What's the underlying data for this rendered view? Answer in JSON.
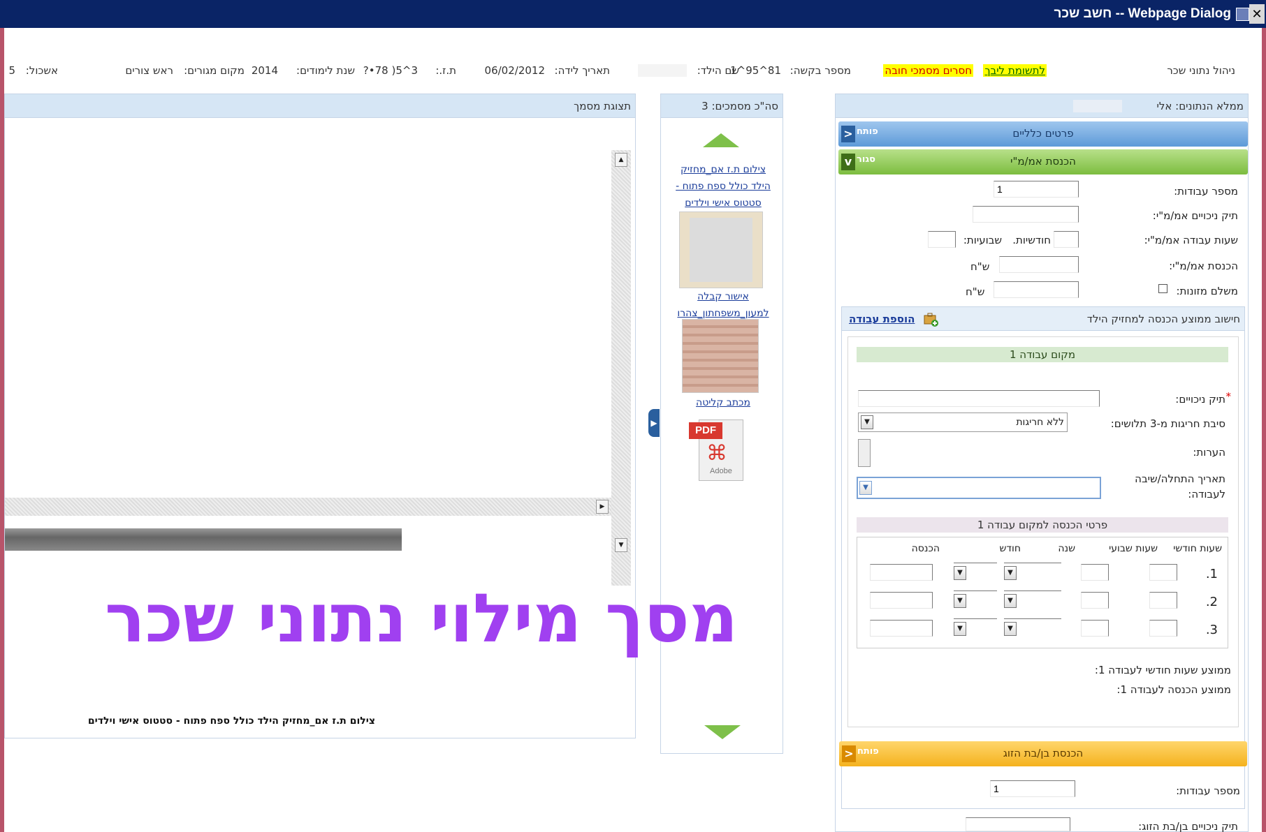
{
  "window": {
    "title": "Webpage Dialog -- חשב שכר",
    "close_glyph": "✕"
  },
  "info_bar": {
    "manage_title": "ניהול נתוני שכר",
    "badge_attention": "לתשומת ליבך",
    "badge_missing": "חסרים מסמכי חובה",
    "request_label": "מספר בקשה:",
    "request_value": "1‏8^95^1",
    "child_label": "שם הילד:",
    "child_value": "",
    "dob_label": "תאריך לידה:",
    "dob_value": "06/02/2012",
    "id_label": "ת.ז.:",
    "id_value": "3^5( 78•?",
    "year_label": "שנת לימודים:",
    "year_value": "2014",
    "residence_label": "מקום מגורים:",
    "residence_value": "ראש צורים",
    "cluster_label": "אשכול:",
    "cluster_value": "5"
  },
  "right_panel": {
    "filler_label": "ממלא הנתונים: אלי",
    "sections": {
      "general": {
        "label": "פרטים כלליים",
        "tag": "פותח",
        "chevron": "<"
      },
      "income": {
        "label": "הכנסת אמ/מ\"י",
        "tag": "סגור",
        "chevron": "v"
      },
      "spouse": {
        "label": "הכנסת בן/בת הזוג",
        "tag": "פותח",
        "chevron": "<"
      }
    },
    "fields": {
      "jobs_count_label": "מספר עבודות:",
      "jobs_count_value": "1",
      "deductions_file_label": "תיק ניכויים אמ/מ\"י:",
      "work_hours_label": "שעות עבודה אמ/מ\"י:",
      "monthly_label": "חודשיות.",
      "weekly_label": "שבועיות:",
      "income_label": "הכנסת אמ/מ\"י:",
      "shekel": "ש\"ח",
      "alimony_label": "משלם מזונות:"
    },
    "avg_calc": {
      "title": "חישוב ממוצע הכנסה למחזיק הילד",
      "add_job_link": "הוספת עבודה",
      "workplace_bar": "מקום עבודה 1",
      "deductions_label": "תיק ניכויים:",
      "deviation_label": "סיבת חריגות מ-3 תלושים:",
      "deviation_value": "ללא חריגות",
      "notes_label": "הערות:",
      "start_date_label_1": "תאריך התחלה/שיבה",
      "start_date_label_2": "לעבודה:",
      "income_details_bar": "פרטי הכנסה למקום עבודה 1",
      "table_headers": [
        "שעות חודשי",
        "שעות שבועי",
        "שנה",
        "חודש",
        "הכנסה"
      ],
      "rows": [
        "1.",
        "2.",
        "3."
      ],
      "avg_hours_label": "ממוצע שעות חודשי לעבודה 1:",
      "avg_income_label": "ממוצע הכנסה לעבודה 1:"
    },
    "spouse_fields": {
      "jobs_count_label": "מספר עבודות:",
      "jobs_count_value": "1",
      "deductions_file_label": "תיק ניכויים בן/בת הזוג:"
    }
  },
  "middle_panel": {
    "total_docs": "סה\"כ מסמכים: 3",
    "docs": [
      {
        "title": "צילום ת.ז אם_מחזיק הילד כולל ספח פתוח - סטטוס אישי וילדים"
      },
      {
        "title": "אישור קבלה למעון_משפחתון_צהרו"
      },
      {
        "title": "מכתב קליטה"
      }
    ],
    "pdf_label": "PDF",
    "adobe_label": "Adobe"
  },
  "left_panel": {
    "title": "תצוגת מסמך",
    "caption": "צילום ת.ז אם_מחזיק הילד כולל ספח פתוח - סטטוס אישי וילדים"
  },
  "overlay_text": "מסך מילוי נתוני שכר",
  "colors": {
    "titlebar": "#0a2466",
    "overlay": "#a040f0",
    "accordion_blue": "#5d9ad8",
    "accordion_green": "#7cbd3f",
    "accordion_orange": "#f4b21e"
  }
}
